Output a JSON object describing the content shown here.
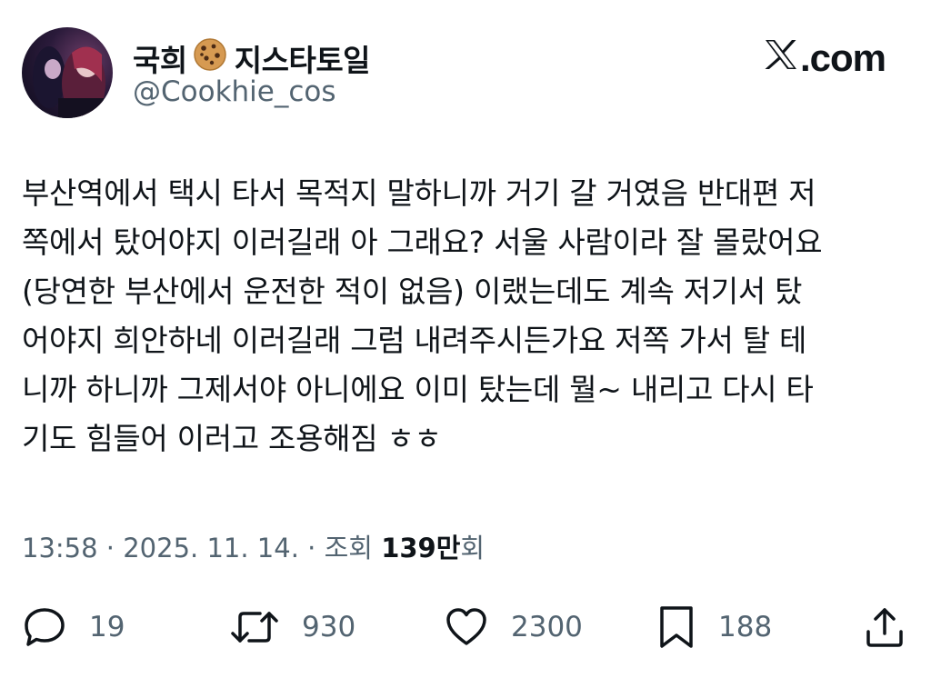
{
  "author": {
    "display_name": "국희",
    "display_name_suffix": "지스타토일",
    "handle": "@Cookhie_cos"
  },
  "brand": {
    "logo_text": ".com"
  },
  "tweet": {
    "lines": [
      "부산역에서 택시 타서 목적지 말하니까 거기 갈 거였음 반대편 저",
      "쪽에서 탔어야지 이러길래 아 그래요? 서울 사람이라 잘 몰랐어요",
      "(당연한 부산에서 운전한 적이 없음) 이랬는데도 계속 저기서 탔",
      "어야지 희안하네 이러길래 그럼 내려주시든가요 저쪽 가서 탈 테",
      "니까 하니까 그제서야 아니에요 이미 탔는데 뭘~ 내리고 다시 타",
      "기도 힘들어 이러고 조용해짐 ㅎㅎ"
    ]
  },
  "meta": {
    "time": "13:58",
    "date": "2025. 11. 14.",
    "views_label": "조회",
    "views_count": "139만",
    "views_unit": "회"
  },
  "actions": {
    "reply_count": "19",
    "retweet_count": "930",
    "like_count": "2300",
    "bookmark_count": "188"
  },
  "colors": {
    "text": "#0f1419",
    "secondary": "#536471"
  },
  "icons": [
    "cookie-icon",
    "x-logo-icon",
    "reply-icon",
    "retweet-icon",
    "heart-icon",
    "bookmark-icon",
    "share-icon"
  ]
}
